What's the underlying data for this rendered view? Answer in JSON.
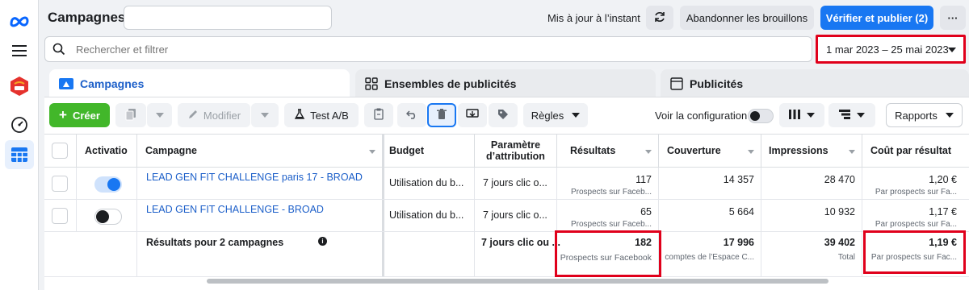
{
  "header": {
    "title": "Campagnes",
    "updated_text": "Mis à jour à l’instant",
    "discard_label": "Abandonner les brouillons",
    "publish_label": "Vérifier et publier (2)",
    "more_label": "···"
  },
  "search": {
    "placeholder": "Rechercher et filtrer"
  },
  "date_range": "1 mar 2023 – 25 mai 2023",
  "tabs": [
    {
      "label": "Campagnes"
    },
    {
      "label": "Ensembles de publicités"
    },
    {
      "label": "Publicités"
    }
  ],
  "toolbar": {
    "create_label": "Créer",
    "edit_label": "Modifier",
    "abtest_label": "Test A/B",
    "rules_label": "Règles",
    "view_config_label": "Voir la configuration",
    "reports_label": "Rapports"
  },
  "table": {
    "columns": {
      "activation": "Activatio",
      "campaign": "Campagne",
      "budget": "Budget",
      "attribution_line1": "Paramètre",
      "attribution_line2": "d’attribution",
      "results": "Résultats",
      "reach": "Couverture",
      "impressions": "Impressions",
      "cost": "Coût par résultat"
    },
    "rows": [
      {
        "campaign": "LEAD GEN FIT CHALLENGE paris 17 - BROAD",
        "active": true,
        "budget": "Utilisation du b...",
        "attribution": "7 jours clic o...",
        "results": "117",
        "results_sub": "Prospects sur Faceb...",
        "reach": "14 357",
        "impressions": "28 470",
        "cost": "1,20 €",
        "cost_sub": "Par prospects sur Fa..."
      },
      {
        "campaign": "LEAD GEN FIT CHALLENGE - BROAD",
        "active": false,
        "budget": "Utilisation du b...",
        "attribution": "7 jours clic o...",
        "results": "65",
        "results_sub": "Prospects sur Faceb...",
        "reach": "5 664",
        "impressions": "10 932",
        "cost": "1,17 €",
        "cost_sub": "Par prospects sur Fa..."
      }
    ],
    "total": {
      "label": "Résultats pour 2 campagnes",
      "attribution": "7 jours clic ou ...",
      "results": "182",
      "results_sub": "Prospects sur Facebook",
      "reach": "17 996",
      "reach_sub": "comptes de l’Espace C...",
      "impressions": "39 402",
      "impressions_sub": "Total",
      "cost": "1,19 €",
      "cost_sub": "Par prospects sur Fac..."
    }
  },
  "colors": {
    "accent": "#1877f2",
    "create_green": "#42b72a",
    "highlight_red": "#e0001b"
  },
  "icons": [
    "meta-logo-icon",
    "menu-icon",
    "five-logo-icon",
    "gauge-icon",
    "table-icon",
    "search-icon",
    "refresh-icon"
  ]
}
